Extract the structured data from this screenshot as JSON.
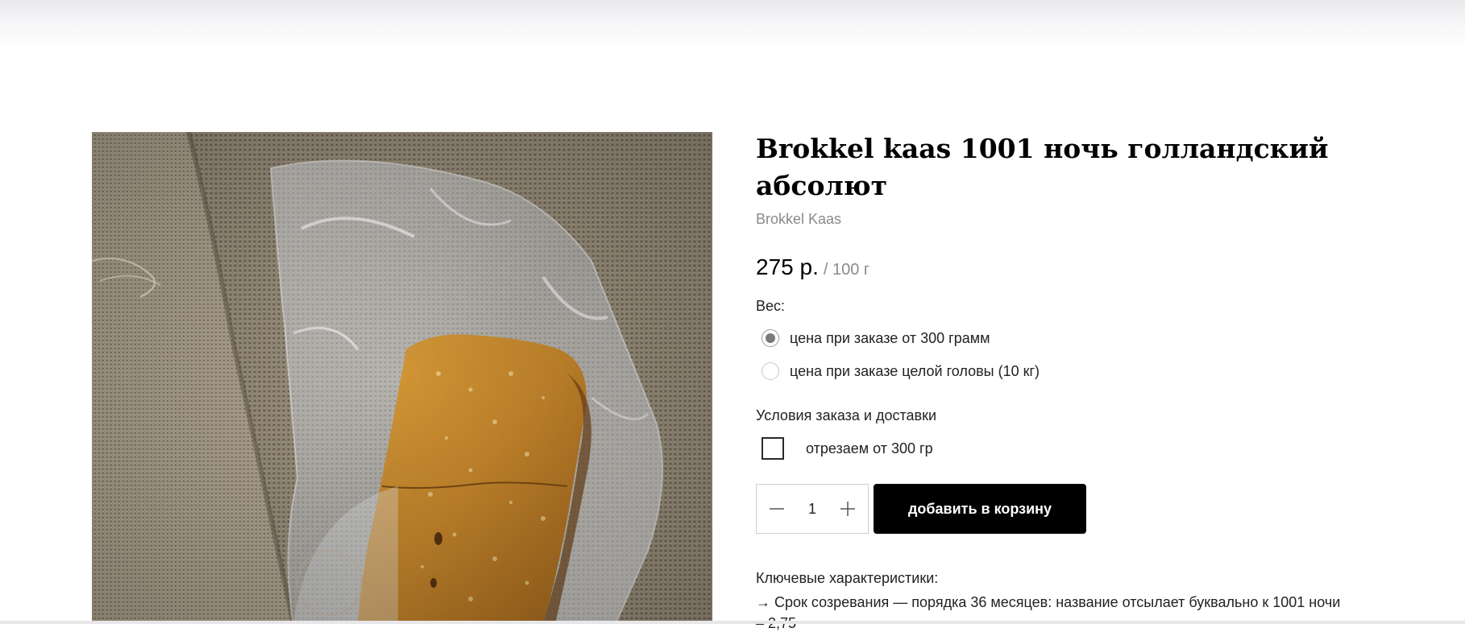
{
  "product": {
    "title": "Brokkel kaas 1001 ночь голландский абсолют",
    "brand": "Brokkel Kaas",
    "price": "275 р.",
    "price_unit": "/ 100 г"
  },
  "weight": {
    "label": "Вес:",
    "options": [
      {
        "label": "цена при заказе от 300 грамм",
        "selected": true
      },
      {
        "label": "цена при заказе целой головы (10 кг)",
        "selected": false
      }
    ]
  },
  "delivery": {
    "label": "Условия заказа и доставки",
    "option_label": "отрезаем от 300 гр",
    "checked": false
  },
  "cart": {
    "quantity": "1",
    "add_label": "добавить в корзину"
  },
  "features": {
    "label": "Ключевые характеристики:",
    "line1": "→ Срок созревания — порядка 36 месяцев: название отсылает буквально к 1001 ночи",
    "line2": "– 2,75"
  },
  "icons": {
    "minus": "minus-icon",
    "plus": "plus-icon"
  }
}
